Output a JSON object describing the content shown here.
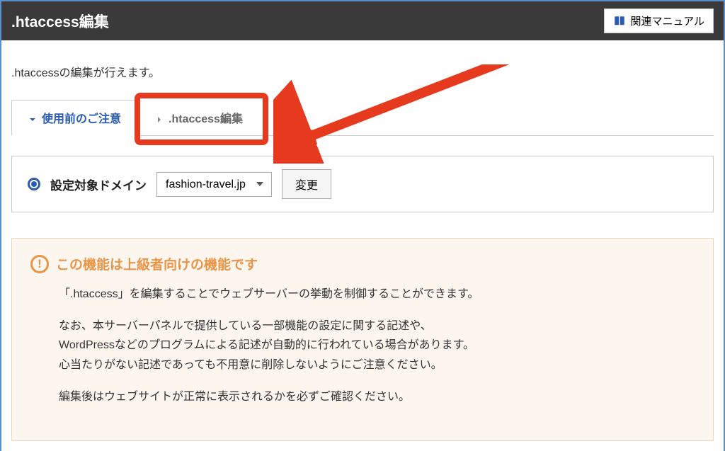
{
  "header": {
    "title": ".htaccess編集",
    "manual_button": "関連マニュアル"
  },
  "intro": ".htaccessの編集が行えます。",
  "tabs": {
    "active": "使用前のご注意",
    "inactive": ".htaccess編集"
  },
  "domain_panel": {
    "label": "設定対象ドメイン",
    "selected": "fashion-travel.jp",
    "change_button": "変更"
  },
  "warning": {
    "title": "この機能は上級者向けの機能です",
    "line1": "「.htaccess」を編集することでウェブサーバーの挙動を制御することができます。",
    "line2": "なお、本サーバーパネルで提供している一部機能の設定に関する記述や、",
    "line3": "WordPressなどのプログラムによる記述が自動的に行われている場合があります。",
    "line4": "心当たりがない記述であっても不用意に削除しないようにご注意ください。",
    "line5": "編集後はウェブサイトが正常に表示されるかを必ずご確認ください。"
  },
  "annotation": {
    "highlight_color": "#e63a1e"
  }
}
